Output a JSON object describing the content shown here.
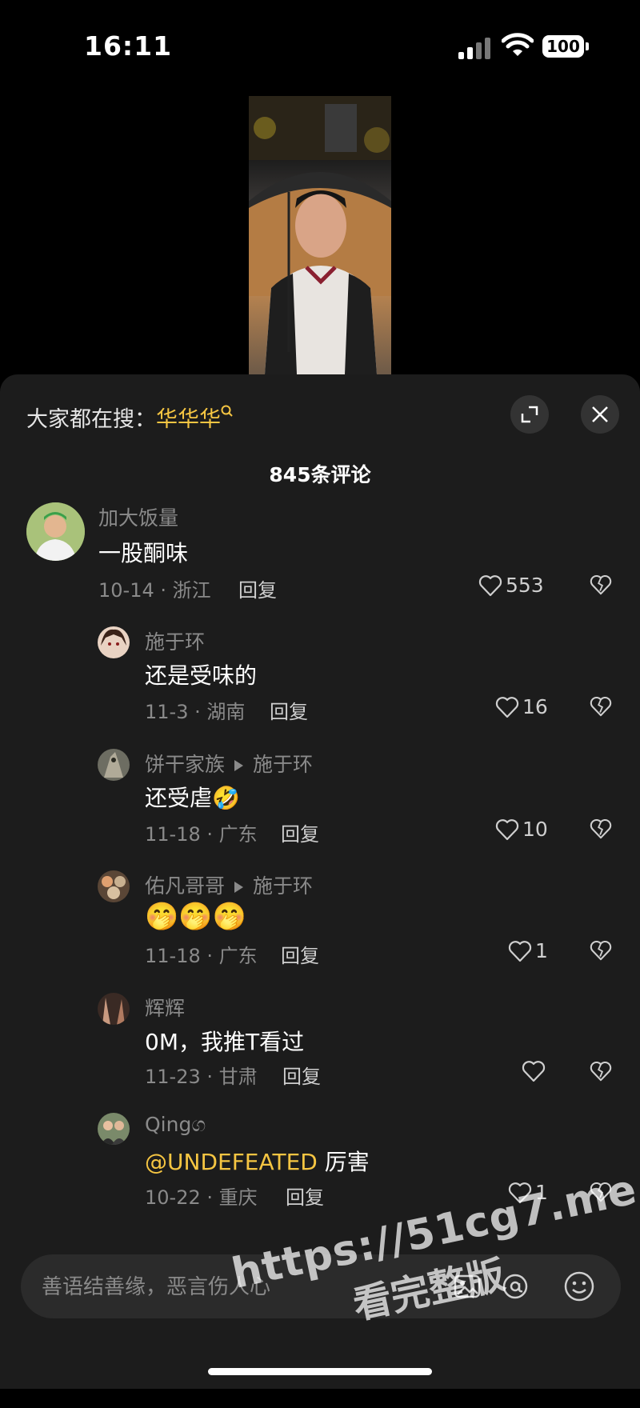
{
  "status_bar": {
    "time": "16:11",
    "battery": "100"
  },
  "panel": {
    "search_prefix": "大家都在搜：",
    "search_keyword": "华华华",
    "comment_count": "845条评论"
  },
  "comments": [
    {
      "name": "加大饭量",
      "text": "一股酮味",
      "meta": "10-14 · 浙江",
      "reply": "回复",
      "likes": "553"
    },
    {
      "name": "施于环",
      "text": "还是受味的",
      "meta": "11-3 · 湖南",
      "reply": "回复",
      "likes": "16"
    },
    {
      "name": "饼干家族",
      "reply_to": "施于环",
      "text": "还受虐",
      "emoji": "🤣",
      "meta": "11-18 · 广东",
      "reply": "回复",
      "likes": "10"
    },
    {
      "name": "佑凡哥哥",
      "reply_to": "施于环",
      "text": "",
      "emoji": "🤭🤭🤭",
      "meta": "11-18 · 广东",
      "reply": "回复",
      "likes": "1"
    },
    {
      "name": "辉辉",
      "text": "0M，我推T看过",
      "meta": "11-23 · 甘肃",
      "reply": "回复",
      "likes": ""
    },
    {
      "name": "Qingග",
      "mention": "@UNDEFEATED",
      "text": " 厉害",
      "meta": "10-22 · 重庆",
      "reply": "回复",
      "likes": "1"
    }
  ],
  "input": {
    "placeholder": "善语结善缘，恶言伤人心"
  },
  "watermark": {
    "line1": "https://51cg7.me",
    "line2": "看完整版"
  },
  "colors": {
    "accent": "#f5c542",
    "panel_bg": "#1c1c1c",
    "muted": "#8a8a8a"
  }
}
